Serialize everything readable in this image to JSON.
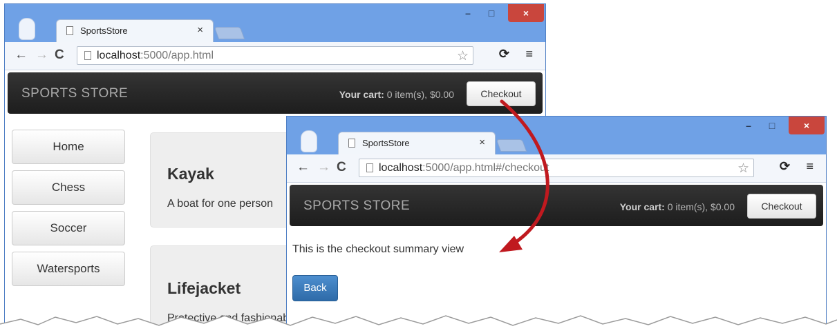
{
  "browser_back": {
    "tab": {
      "title": "SportsStore",
      "close": "×"
    },
    "window_controls": {
      "minimize": "–",
      "maximize": "□",
      "close": "×"
    },
    "toolbar": {
      "back": "←",
      "forward": "→",
      "reload": "C",
      "url_host": "localhost",
      "url_rest": ":5000/app.html",
      "bookmark": "☆",
      "extension": "⟳",
      "menu": "≡"
    },
    "page": {
      "brand": "SPORTS STORE",
      "cart_label": "Your cart:",
      "cart_value": " 0 item(s), $0.00",
      "checkout": "Checkout",
      "categories": [
        "Home",
        "Chess",
        "Soccer",
        "Watersports"
      ],
      "products": [
        {
          "name": "Kayak",
          "description": "A boat for one person"
        },
        {
          "name": "Lifejacket",
          "description": "Protective and fashionable"
        }
      ]
    }
  },
  "browser_front": {
    "tab": {
      "title": "SportsStore",
      "close": "×"
    },
    "window_controls": {
      "minimize": "–",
      "maximize": "□",
      "close": "×"
    },
    "toolbar": {
      "back": "←",
      "forward": "→",
      "reload": "C",
      "url_host": "localhost",
      "url_rest": ":5000/app.html#/checkout",
      "bookmark": "☆",
      "extension": "⟳",
      "menu": "≡"
    },
    "page": {
      "brand": "SPORTS STORE",
      "cart_label": "Your cart:",
      "cart_value": " 0 item(s), $0.00",
      "checkout": "Checkout",
      "message": "This is the checkout summary view",
      "back_button": "Back"
    }
  },
  "colors": {
    "chrome_frame": "#6fa1e6",
    "navbar": "#222222",
    "back_button": "#337ab7",
    "annotation_arrow": "#c0191f",
    "close_button": "#c9463d"
  }
}
